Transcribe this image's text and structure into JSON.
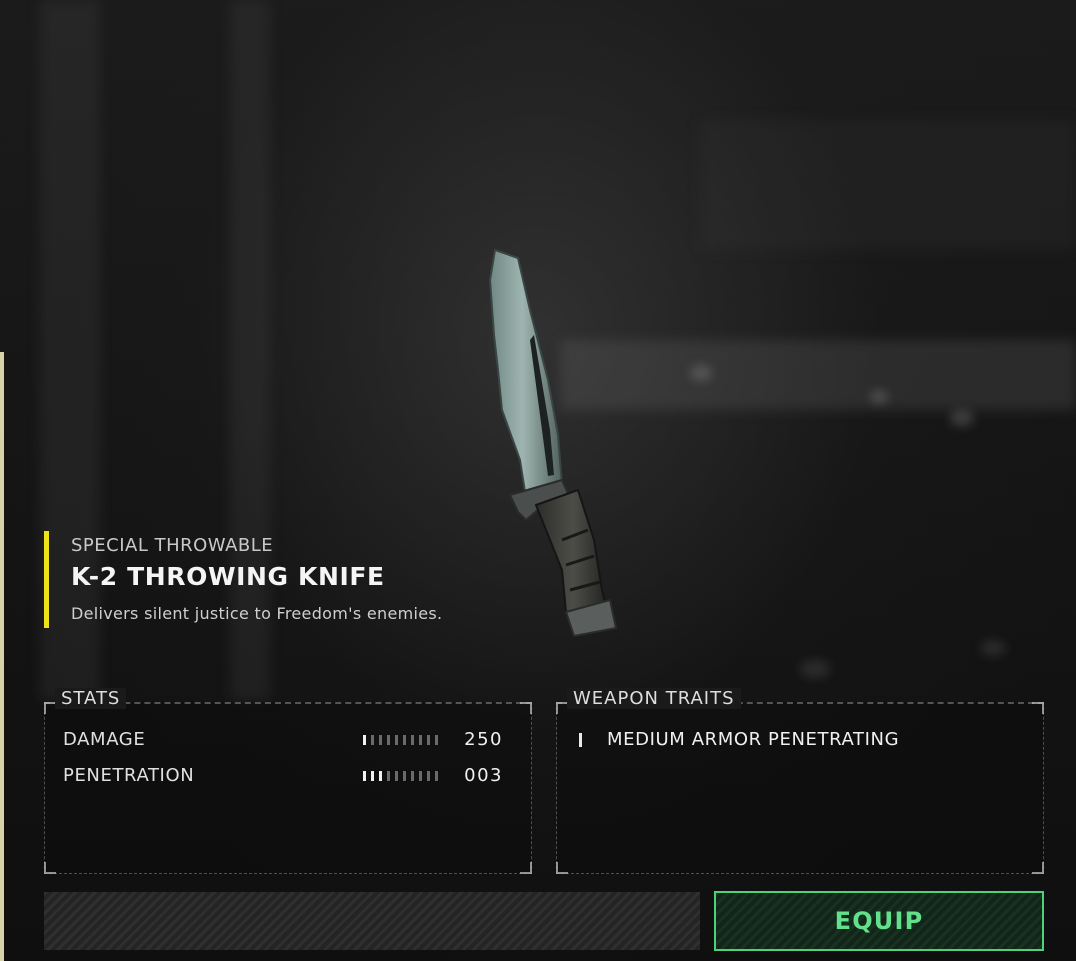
{
  "item": {
    "category": "SPECIAL THROWABLE",
    "name": "K-2 THROWING KNIFE",
    "description": "Delivers silent justice to Freedom's enemies.",
    "accent_color": "#f0e21a",
    "illustration_icon": "throwing-knife-icon"
  },
  "stats": {
    "title": "STATS",
    "rows": [
      {
        "label": "DAMAGE",
        "value": "250"
      },
      {
        "label": "PENETRATION",
        "value": "003"
      }
    ]
  },
  "traits": {
    "title": "WEAPON TRAITS",
    "items": [
      {
        "label": "MEDIUM ARMOR PENETRATING"
      }
    ]
  },
  "actions": {
    "equip_label": "EQUIP",
    "equip_color": "#4fd07a"
  }
}
